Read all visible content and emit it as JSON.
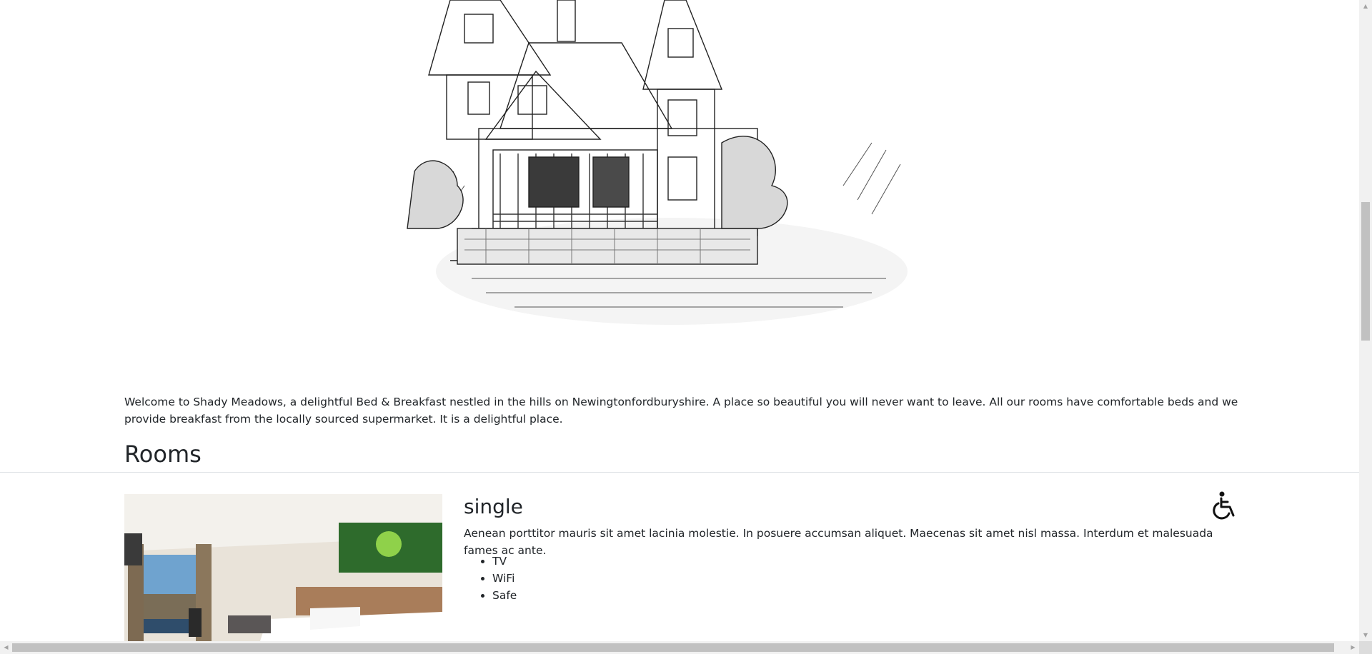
{
  "welcome": {
    "text": "Welcome to Shady Meadows, a delightful Bed & Breakfast nestled in the hills on Newingtonfordburyshire. A place so beautiful you will never want to leave. All our rooms have comfortable beds and we provide breakfast from the locally sourced supermarket. It is a delightful place."
  },
  "rooms": {
    "heading": "Rooms",
    "items": [
      {
        "name": "single",
        "description": "Aenean porttitor mauris sit amet lacinia molestie. In posuere accumsan aliquet. Maecenas sit amet nisl massa. Interdum et malesuada fames ac ante.",
        "features": [
          "TV",
          "WiFi",
          "Safe"
        ],
        "accessible": true
      }
    ]
  },
  "icons": {
    "accessibility": "wheelchair-icon",
    "hero": "house-sketch-image",
    "room": "hotel-room-photo"
  },
  "scrollbars": {
    "arrow_up": "▲",
    "arrow_down": "▼",
    "arrow_left": "◀",
    "arrow_right": "▶"
  }
}
